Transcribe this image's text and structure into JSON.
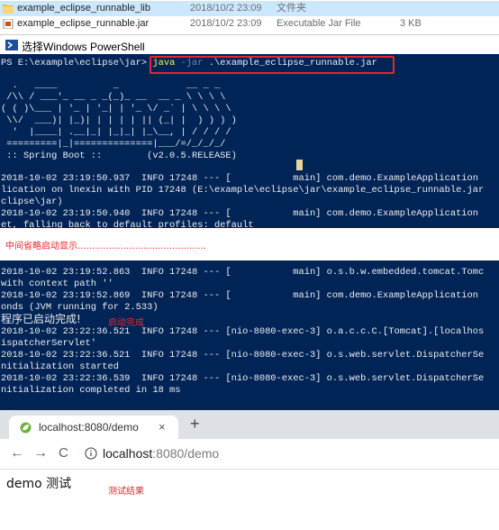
{
  "explorer": {
    "rows": [
      {
        "name": "example_eclipse_runnable_lib",
        "date": "2018/10/2 23:09",
        "type": "文件夹",
        "size": ""
      },
      {
        "name": "example_eclipse_runnable.jar",
        "date": "2018/10/2 23:09",
        "type": "Executable Jar File",
        "size": "3 KB"
      }
    ]
  },
  "powershell": {
    "title": "选择Windows PowerShell",
    "prompt": "PS E:\\example\\eclipse\\jar>",
    "cmd_java": "java",
    "cmd_flag": "-jar",
    "cmd_arg": ".\\example_eclipse_runnable.jar",
    "banner": [
      "  .   ____          _            __ _ _",
      " /\\\\ / ___'_ __ _ _(_)_ __  __ _ \\ \\ \\ \\",
      "( ( )\\___ | '_ | '_| | '_ \\/ _` | \\ \\ \\ \\",
      " \\\\/  ___)| |_)| | | | | || (_| |  ) ) ) )",
      "  '  |____| .__|_| |_|_| |_\\__, | / / / /",
      " =========|_|==============|___/=/_/_/_/",
      " :: Spring Boot ::        (v2.0.5.RELEASE)"
    ],
    "log_top": [
      "2018-10-02 23:19:50.937  INFO 17248 --- [           main] com.demo.ExampleApplication",
      "lication on lnexin with PID 17248 (E:\\example\\eclipse\\jar\\example_eclipse_runnable.jar",
      "clipse\\jar)",
      "2018-10-02 23:19:50.940  INFO 17248 --- [           main] com.demo.ExampleApplication",
      "et, falling back to default profiles: default"
    ],
    "annotation_middle": "中间省略启动显示.............................................",
    "log_bottom": [
      "2018-10-02 23:19:52.863  INFO 17248 --- [           main] o.s.b.w.embedded.tomcat.Tomc",
      "with context path ''",
      "2018-10-02 23:19:52.869  INFO 17248 --- [           main] com.demo.ExampleApplication",
      "onds (JVM running for 2.533)"
    ],
    "completion_text": "程序已启动完成!",
    "annotation_complete": "启动完成",
    "log_end": [
      "2018-10-02 23:22:36.521  INFO 17248 --- [nio-8080-exec-3] o.a.c.c.C.[Tomcat].[localhos",
      "ispatcherServlet'",
      "2018-10-02 23:22:36.521  INFO 17248 --- [nio-8080-exec-3] o.s.web.servlet.DispatcherSe",
      "nitialization started",
      "2018-10-02 23:22:36.539  INFO 17248 --- [nio-8080-exec-3] o.s.web.servlet.DispatcherSe",
      "nitialization completed in 18 ms"
    ]
  },
  "browser": {
    "tab_title": "localhost:8080/demo",
    "tab_close": "×",
    "new_tab": "+",
    "back": "←",
    "forward": "→",
    "reload": "C",
    "address_host": "localhost",
    "address_path": ":8080/demo",
    "page_text": "demo 测试",
    "annotation_result": "测试结果"
  },
  "colors": {
    "console_bg": "#012456",
    "annotation": "#e8262b",
    "prompt_keyword": "#f7f35d"
  }
}
